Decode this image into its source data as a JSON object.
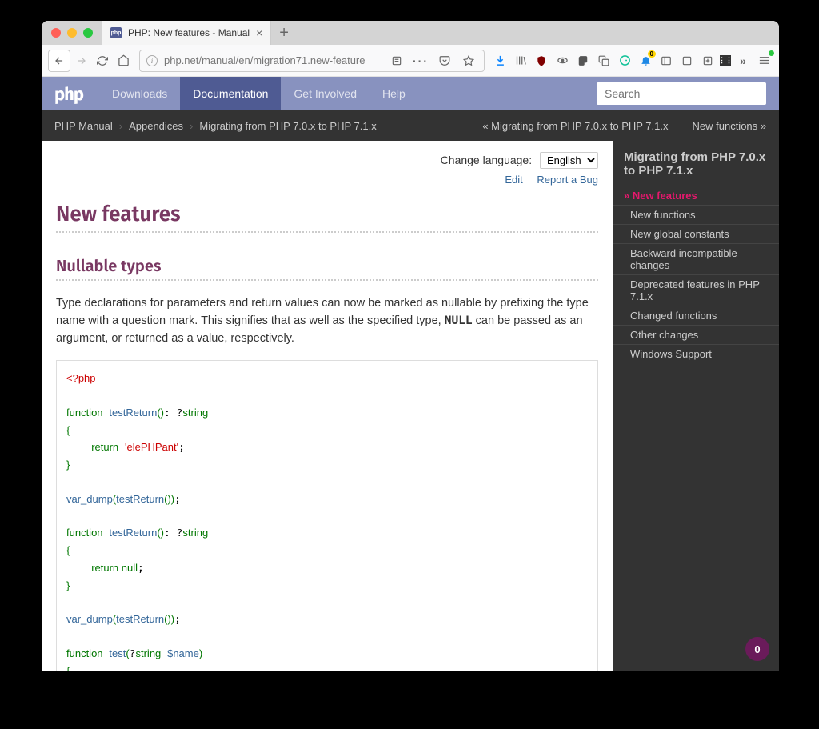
{
  "browser": {
    "tab_title": "PHP: New features - Manual",
    "url": "php.net/manual/en/migration71.new-feature",
    "badge_count": "0",
    "dl_badge": "0"
  },
  "nav": {
    "logo": "php",
    "items": [
      "Downloads",
      "Documentation",
      "Get Involved",
      "Help"
    ],
    "search_placeholder": "Search"
  },
  "breadcrumbs": {
    "items": [
      "PHP Manual",
      "Appendices",
      "Migrating from PHP 7.0.x to PHP 7.1.x"
    ],
    "prev": "« Migrating from PHP 7.0.x to PHP 7.1.x",
    "next": "New functions »"
  },
  "doc": {
    "change_lang_label": "Change language:",
    "lang_select": "English",
    "edit": "Edit",
    "report": "Report a Bug",
    "title": "New features",
    "section": "Nullable types",
    "para_before": "Type declarations for parameters and return values can now be marked as nullable by prefixing the type name with a question mark. This signifies that as well as the specified type, ",
    "para_null": "NULL",
    "para_after": " can be passed as an argument, or returned as a value, respectively."
  },
  "sidebar": {
    "heading": "Migrating from PHP 7.0.x to PHP 7.1.x",
    "items": [
      {
        "label": "New features",
        "current": true
      },
      {
        "label": "New functions"
      },
      {
        "label": "New global constants"
      },
      {
        "label": "Backward incompatible changes"
      },
      {
        "label": "Deprecated features in PHP 7.1.x"
      },
      {
        "label": "Changed functions"
      },
      {
        "label": "Other changes"
      },
      {
        "label": "Windows Support"
      }
    ]
  }
}
